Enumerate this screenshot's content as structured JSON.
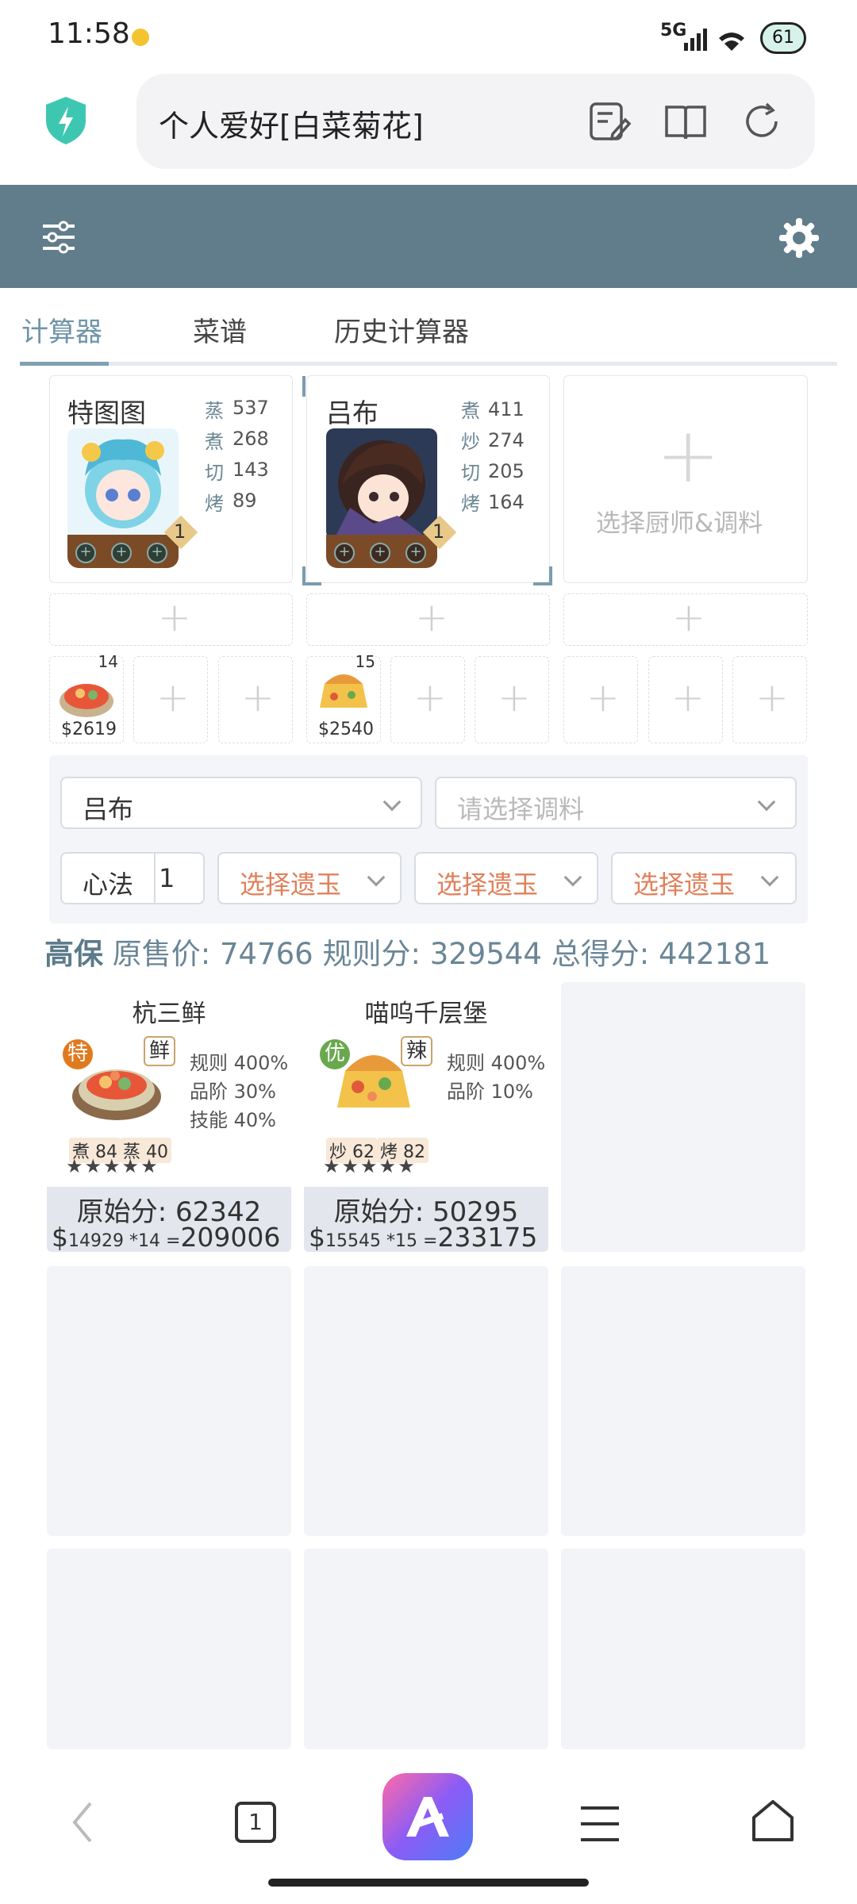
{
  "status_bar": {
    "time": "11:58",
    "network": "5G",
    "battery": "61"
  },
  "browser": {
    "url_text": "个人爱好[白菜菊花]"
  },
  "tabs": [
    {
      "label": "计算器",
      "active": true
    },
    {
      "label": "菜谱",
      "active": false
    },
    {
      "label": "历史计算器",
      "active": false
    }
  ],
  "chefs": [
    {
      "name": "特图图",
      "level": "1",
      "skills": [
        {
          "label": "蒸",
          "value": "537"
        },
        {
          "label": "煮",
          "value": "268"
        },
        {
          "label": "切",
          "value": "143"
        },
        {
          "label": "烤",
          "value": "89"
        }
      ]
    },
    {
      "name": "吕布",
      "level": "1",
      "skills": [
        {
          "label": "煮",
          "value": "411"
        },
        {
          "label": "炒",
          "value": "274"
        },
        {
          "label": "切",
          "value": "205"
        },
        {
          "label": "烤",
          "value": "164"
        }
      ]
    }
  ],
  "empty_chef_label": "选择厨师&调料",
  "dish_thumbs": [
    {
      "count": "14",
      "price": "$2619"
    },
    {
      "count": "15",
      "price": "$2540"
    }
  ],
  "panel": {
    "chef_select": "吕布",
    "seasoning_placeholder": "请选择调料",
    "xinfa_label": "心法",
    "xinfa_value": "1",
    "relic_label": "选择遗玉"
  },
  "score_bar": {
    "guarantee": "高保",
    "original_price_label": "原售价:",
    "original_price": "74766",
    "rule_label": "规则分:",
    "rule_score": "329544",
    "total_label": "总得分:",
    "total_score": "442181"
  },
  "dishes": [
    {
      "name": "杭三鲜",
      "grade": "特",
      "grade_color": "#e07a1f",
      "flavor": "鲜",
      "rules": [
        "规则 400%",
        "品阶 30%",
        "技能 40%"
      ],
      "skills": [
        {
          "label": "煮",
          "value": "84"
        },
        {
          "label": "蒸",
          "value": "40"
        }
      ],
      "stars": "★★★★★",
      "original": "原始分: 62342",
      "price": "14929",
      "qty": "*14",
      "eq": "=",
      "total": "209006"
    },
    {
      "name": "喵呜千层堡",
      "grade": "优",
      "grade_color": "#6aa84f",
      "flavor": "辣",
      "rules": [
        "规则 400%",
        "品阶 10%"
      ],
      "skills": [
        {
          "label": "炒",
          "value": "62"
        },
        {
          "label": "烤",
          "value": "82"
        }
      ],
      "stars": "★★★★★",
      "original": "原始分: 50295",
      "price": "15545",
      "qty": "*15",
      "eq": "=",
      "total": "233175"
    }
  ],
  "colors": {
    "toolbar": "#617d8b",
    "active_tab": "#6f94a8",
    "relic_text": "#e0805a"
  },
  "icons": [
    "shield-icon",
    "note-edit-icon",
    "book-icon",
    "refresh-icon",
    "filter-icon",
    "gear-icon",
    "back-icon",
    "tabs-icon",
    "app-logo-icon",
    "menu-icon",
    "home-icon"
  ],
  "nav": {
    "tab_count": "1"
  }
}
